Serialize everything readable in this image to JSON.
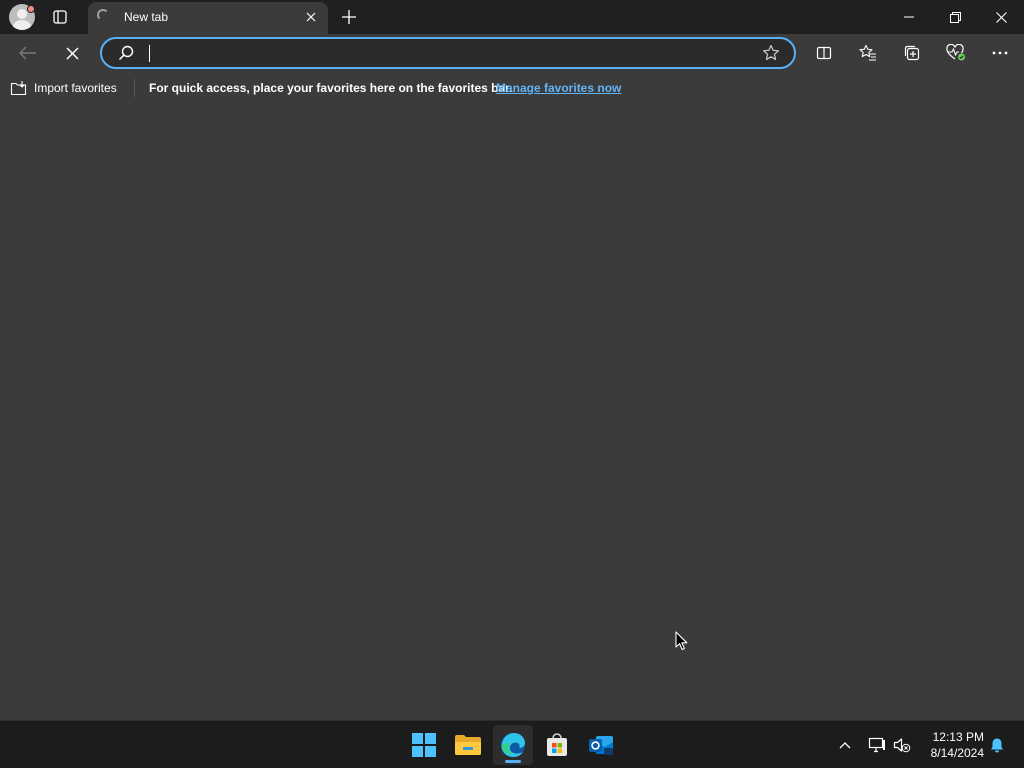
{
  "browser": {
    "tab": {
      "title": "New tab"
    },
    "address_bar": {
      "value": "",
      "placeholder": ""
    },
    "favorites_bar": {
      "import_label": "Import favorites",
      "hint_text": "For quick access, place your favorites here on the favorites bar.",
      "manage_link": "Manage favorites now"
    },
    "icons": {
      "profile": "profile-avatar-icon",
      "tab_actions": "tab-actions-icon",
      "loading": "loading-spinner-icon",
      "tab_close": "close-icon",
      "new_tab": "plus-icon",
      "minimize": "minimize-icon",
      "restore": "restore-icon",
      "close_window": "close-icon",
      "back": "back-arrow-icon",
      "stop": "stop-icon",
      "search": "search-icon",
      "favorite_star": "star-icon",
      "split_screen": "split-screen-icon",
      "favorites": "favorites-icon",
      "collections": "collections-icon",
      "browser_essentials": "heart-pulse-icon",
      "more": "more-icon"
    },
    "accent_color": "#5ab0f5",
    "link_color": "#63b4f6"
  },
  "taskbar": {
    "apps": [
      {
        "name": "Start",
        "icon": "windows-icon"
      },
      {
        "name": "File Explorer",
        "icon": "folder-icon"
      },
      {
        "name": "Microsoft Edge",
        "icon": "edge-icon",
        "active": true
      },
      {
        "name": "Microsoft Store",
        "icon": "store-icon"
      },
      {
        "name": "Outlook (new)",
        "icon": "outlook-icon"
      }
    ],
    "tray": {
      "icons": [
        "chevron-up-icon",
        "network-icon",
        "volume-muted-icon",
        "notification-bell-icon"
      ],
      "time": "12:13 PM",
      "date": "8/14/2024"
    }
  }
}
